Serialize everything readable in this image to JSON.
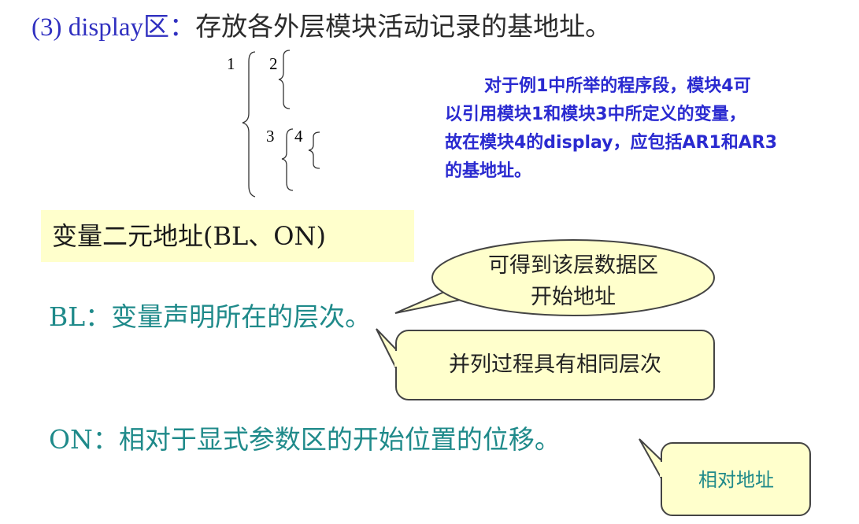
{
  "heading": {
    "prefix": "(3) display区：",
    "text": "存放各外层模块活动记录的基地址。"
  },
  "nesting": {
    "labels": [
      "1",
      "2",
      "3",
      "4"
    ]
  },
  "note": {
    "lines": [
      "对于例1中所举的程序段，模块4可",
      "以引用模块1和模块3中所定义的变量，",
      "故在模块4的display，应包括AR1和AR3",
      "的基地址。"
    ]
  },
  "variable_address": {
    "title": "变量二元地址(BL、ON)"
  },
  "bl": {
    "text": "BL：变量声明所在的层次。"
  },
  "on": {
    "text": "ON：相对于显式参数区的开始位置的位移。"
  },
  "callouts": {
    "ellipse": {
      "line1": "可得到该层数据区",
      "line2": "开始地址"
    },
    "box1": {
      "text": "并列过程具有相同层次"
    },
    "box2": {
      "text": "相对地址"
    }
  },
  "colors": {
    "heading_accent": "#3030c0",
    "note_text": "#2a2ad0",
    "teal_text": "#1f8a8a",
    "callout_fill": "#ffffcc",
    "callout_stroke": "#444444"
  }
}
